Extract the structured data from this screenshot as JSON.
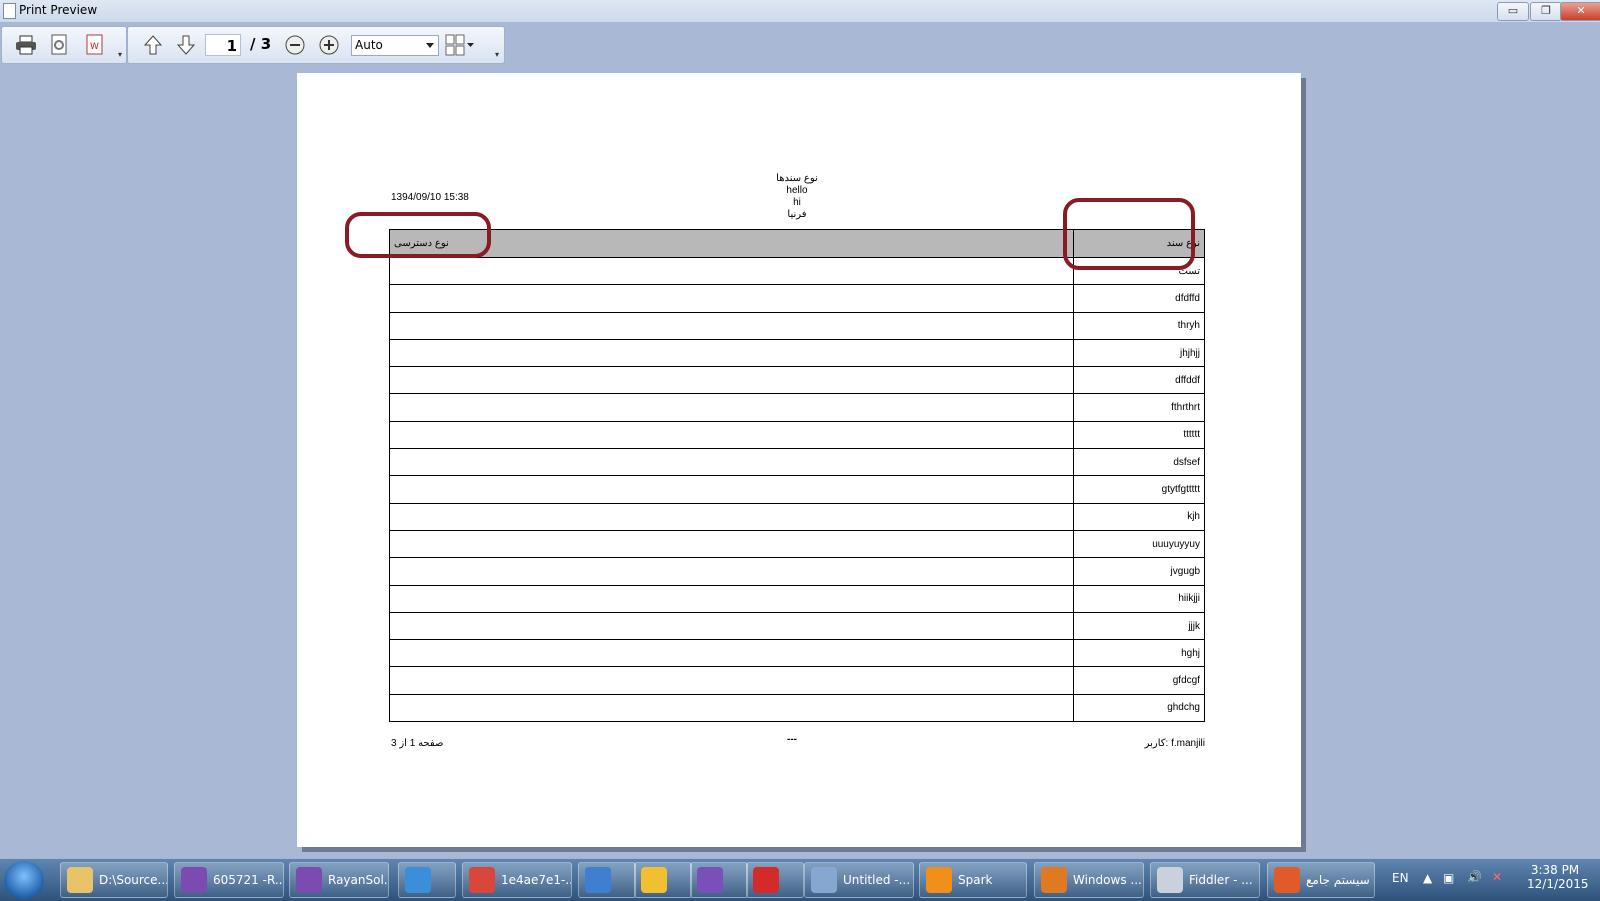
{
  "window": {
    "title": "Print Preview",
    "buttons": {
      "minimize": "▭",
      "restore": "❐",
      "close": "✕"
    }
  },
  "toolbar": {
    "page_current": "1",
    "page_total": "/ 3",
    "zoom": "Auto",
    "icons": [
      "print-icon",
      "page-setup-icon",
      "export-pdf-icon",
      "previous-page-icon",
      "next-page-icon",
      "zoom-out-icon",
      "zoom-in-icon",
      "page-layout-icon"
    ]
  },
  "report": {
    "date": "1394/09/10 15:38",
    "title_lines": [
      "نوع سندها",
      "hello",
      "hi",
      "فرنیا"
    ],
    "headers": {
      "access": "نوع دسترسی",
      "doctype": "نوع سند"
    },
    "rows": [
      {
        "access": "",
        "doctype": "تست"
      },
      {
        "access": "",
        "doctype": "dfdffd"
      },
      {
        "access": "",
        "doctype": "thryh"
      },
      {
        "access": "",
        "doctype": "jhjhjj"
      },
      {
        "access": "",
        "doctype": "dffddf"
      },
      {
        "access": "",
        "doctype": "fthrthrt"
      },
      {
        "access": "",
        "doctype": "tttttt"
      },
      {
        "access": "",
        "doctype": "dsfsef"
      },
      {
        "access": "",
        "doctype": "gtytfgttttt"
      },
      {
        "access": "",
        "doctype": "kjh"
      },
      {
        "access": "",
        "doctype": "uuuyuyyuy"
      },
      {
        "access": "",
        "doctype": "jvgugb"
      },
      {
        "access": "",
        "doctype": "hiikjji"
      },
      {
        "access": "",
        "doctype": "jjjk"
      },
      {
        "access": "",
        "doctype": "hghj"
      },
      {
        "access": "",
        "doctype": "gfdcgf"
      },
      {
        "access": "",
        "doctype": "ghdchg"
      }
    ],
    "footer_left": "صفحه 1 از 3",
    "footer_mid": "---",
    "footer_right": "کاربر: f.manjili"
  },
  "taskbar": {
    "items": [
      {
        "label": "D:\\Source...",
        "color": "#e8c36a"
      },
      {
        "label": "605721 -R...",
        "color": "#7b4bb0"
      },
      {
        "label": "RayanSol...",
        "color": "#7b4bb0"
      },
      {
        "label": "",
        "color": "#3a8fd8"
      },
      {
        "label": "1e4ae7e1-...",
        "color": "#d9473c"
      },
      {
        "label": "",
        "color": "#3f7fd0"
      },
      {
        "label": "",
        "color": "#f0c030"
      },
      {
        "label": "",
        "color": "#7a4fb8"
      },
      {
        "label": "",
        "color": "#d42a2a"
      },
      {
        "label": "Untitled -...",
        "color": "#86a7d0"
      },
      {
        "label": "Spark",
        "color": "#f0901a"
      },
      {
        "label": "Windows ...",
        "color": "#e07a20"
      },
      {
        "label": "Fiddler - ...",
        "color": "#c9d2dc"
      },
      {
        "label": "سیستم جامع",
        "color": "#e05a2a"
      }
    ],
    "lang": "EN",
    "time": "3:38 PM",
    "date": "12/1/2015"
  }
}
